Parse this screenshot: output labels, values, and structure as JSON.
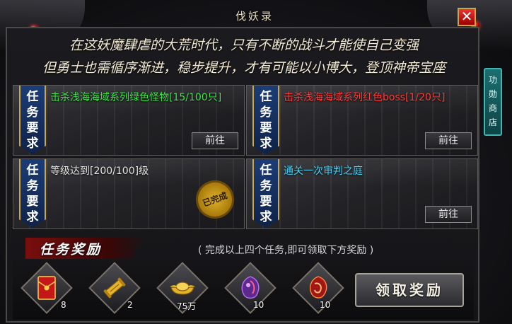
{
  "window": {
    "title": "伐妖录",
    "close_label": "✕"
  },
  "intro": {
    "line1": "在这妖魔肆虐的大荒时代，只有不断的战斗才能使自己变强",
    "line2": "但勇士也需循序渐进，稳步提升，才有可能以小博大，登顶神帝宝座"
  },
  "side_tab": {
    "chars": [
      "功",
      "勋",
      "商",
      "店"
    ]
  },
  "task_ribbon_chars": [
    "任",
    "务",
    "要",
    "求"
  ],
  "tasks": [
    {
      "desc": "击杀浅海海域系列绿色怪物[15/100只]",
      "color": "#3ee64a",
      "button": "前往"
    },
    {
      "desc": "击杀浅海海域系列红色boss[1/20只]",
      "color": "#ff3b3b",
      "button": "前往"
    },
    {
      "desc": "等级达到[200/100]级",
      "color": "#e6e6e6",
      "stamp": "已完成"
    },
    {
      "desc": "通关一次审判之庭",
      "color": "#3fd6ff",
      "button": "前往"
    }
  ],
  "rewards": {
    "title": "任务奖励",
    "note": "( 完成以上四个任务,即可领取下方奖励 )",
    "claim_button": "领取奖励",
    "items": [
      {
        "icon": "red-envelope-icon",
        "count": "8"
      },
      {
        "icon": "golden-scroll-icon",
        "count": "2"
      },
      {
        "icon": "gold-ingot-icon",
        "count": "75万"
      },
      {
        "icon": "purple-gem-icon",
        "count": "10"
      },
      {
        "icon": "red-gem-icon",
        "count": "10"
      }
    ]
  }
}
